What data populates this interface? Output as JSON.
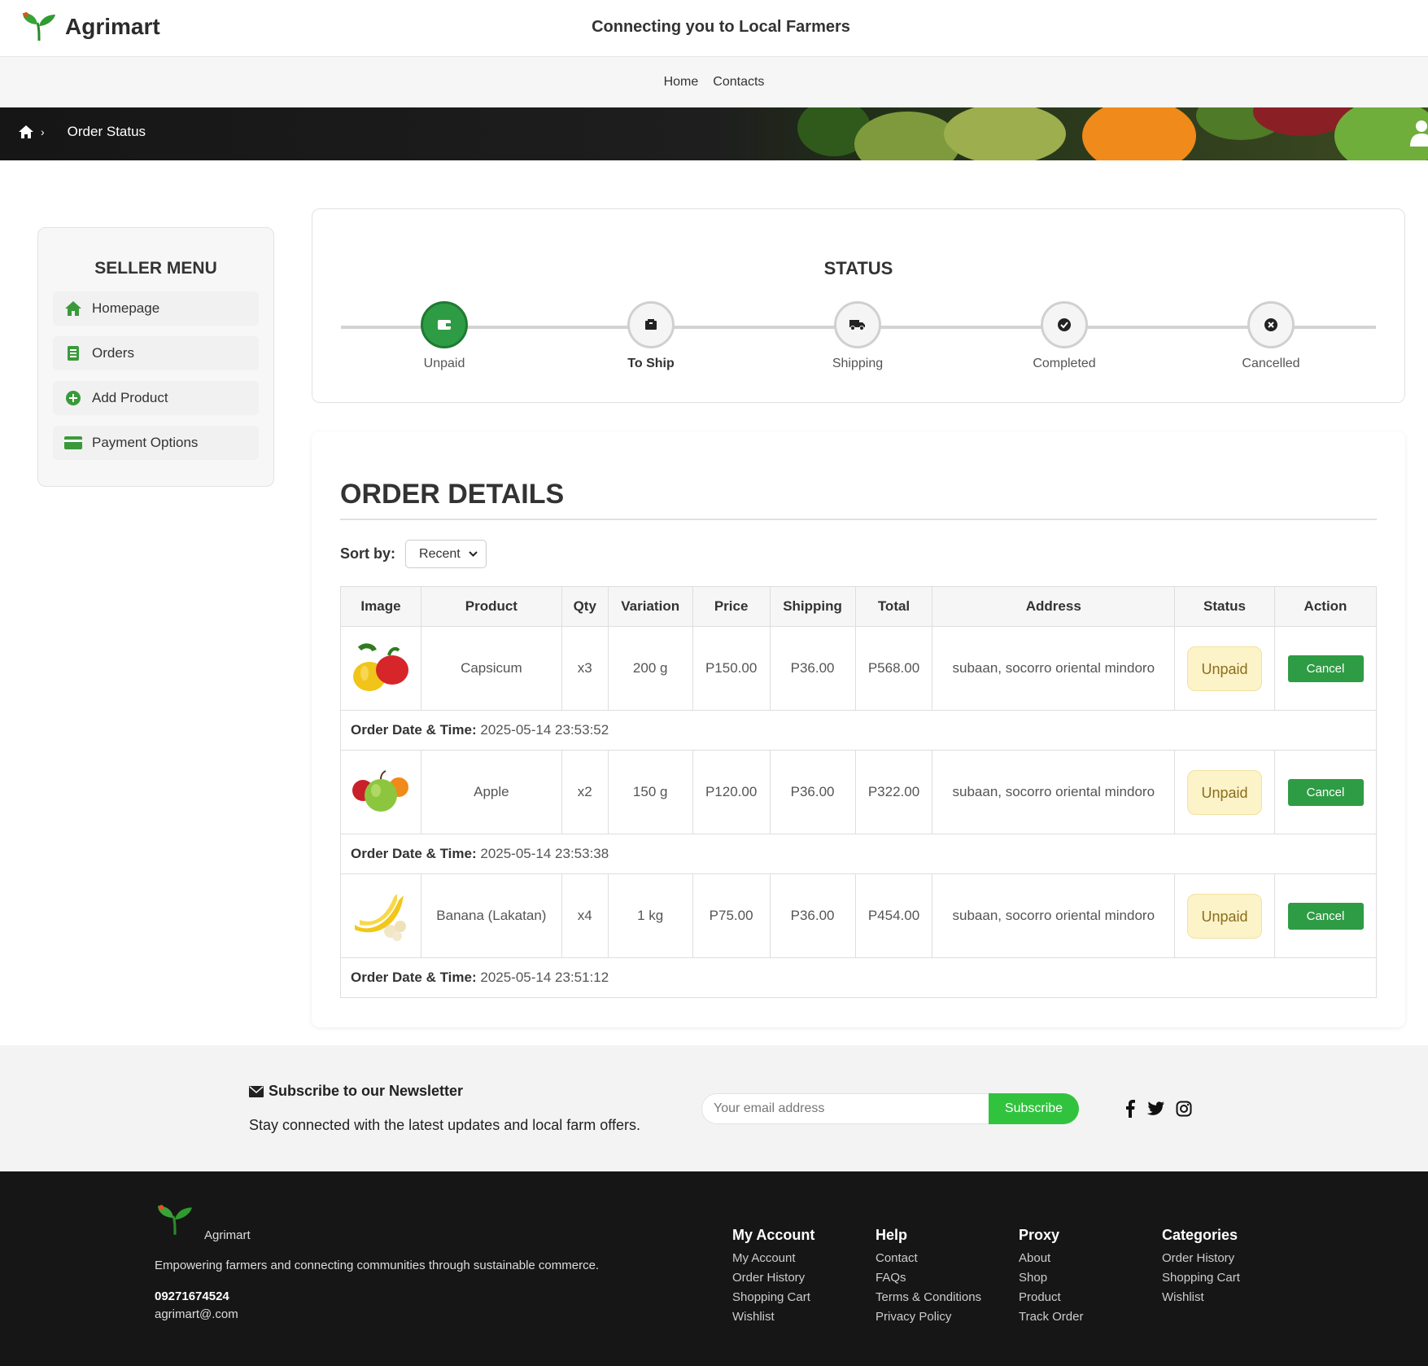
{
  "header": {
    "brand": "Agrimart",
    "tagline": "Connecting you to Local Farmers"
  },
  "nav": {
    "home": "Home",
    "contacts": "Contacts"
  },
  "breadcrumb": {
    "current": "Order Status"
  },
  "sidebar": {
    "title": "SELLER MENU",
    "items": [
      {
        "label": "Homepage",
        "icon": "house-icon"
      },
      {
        "label": "Orders",
        "icon": "clipboard-icon"
      },
      {
        "label": "Add Product",
        "icon": "plus-circle-icon"
      },
      {
        "label": "Payment Options",
        "icon": "credit-card-icon"
      }
    ]
  },
  "status": {
    "title": "STATUS",
    "steps": [
      {
        "label": "Unpaid",
        "icon": "wallet-icon",
        "active": true
      },
      {
        "label": "To Ship",
        "icon": "box-icon",
        "active": false
      },
      {
        "label": "Shipping",
        "icon": "truck-icon",
        "active": false
      },
      {
        "label": "Completed",
        "icon": "check-icon",
        "active": false
      },
      {
        "label": "Cancelled",
        "icon": "x-icon",
        "active": false
      }
    ]
  },
  "order_details": {
    "title": "ORDER DETAILS",
    "sort_label": "Sort by:",
    "sort_value": "Recent",
    "columns": [
      "Image",
      "Product",
      "Qty",
      "Variation",
      "Price",
      "Shipping",
      "Total",
      "Address",
      "Status",
      "Action"
    ],
    "date_label": "Order Date & Time:",
    "orders": [
      {
        "product": "Capsicum",
        "qty": "x3",
        "variation": "200 g",
        "price": "P150.00",
        "shipping": "P36.00",
        "total": "P568.00",
        "address": "subaan, socorro oriental mindoro",
        "status": "Unpaid",
        "action": "Cancel",
        "datetime": "2025-05-14 23:53:52"
      },
      {
        "product": "Apple",
        "qty": "x2",
        "variation": "150 g",
        "price": "P120.00",
        "shipping": "P36.00",
        "total": "P322.00",
        "address": "subaan, socorro oriental mindoro",
        "status": "Unpaid",
        "action": "Cancel",
        "datetime": "2025-05-14 23:53:38"
      },
      {
        "product": "Banana (Lakatan)",
        "qty": "x4",
        "variation": "1 kg",
        "price": "P75.00",
        "shipping": "P36.00",
        "total": "P454.00",
        "address": "subaan, socorro oriental mindoro",
        "status": "Unpaid",
        "action": "Cancel",
        "datetime": "2025-05-14 23:51:12"
      }
    ]
  },
  "newsletter": {
    "title": "Subscribe to our Newsletter",
    "description": "Stay connected with the latest updates and local farm offers.",
    "placeholder": "Your email address",
    "button": "Subscribe"
  },
  "footer": {
    "brand": "Agrimart",
    "description": "Empowering farmers and connecting communities through sustainable commerce.",
    "phone": "09271674524",
    "email": "agrimart@.com",
    "columns": [
      {
        "title": "My Account",
        "links": [
          "My Account",
          "Order History",
          "Shopping Cart",
          "Wishlist"
        ]
      },
      {
        "title": "Help",
        "links": [
          "Contact",
          "FAQs",
          "Terms & Conditions",
          "Privacy Policy"
        ]
      },
      {
        "title": "Proxy",
        "links": [
          "About",
          "Shop",
          "Product",
          "Track Order"
        ]
      },
      {
        "title": "Categories",
        "links": [
          "Order History",
          "Shopping Cart",
          "Wishlist"
        ]
      }
    ]
  },
  "colors": {
    "accent": "#2e9c44",
    "subscribe": "#31c33e",
    "badge_bg": "#fdf3c8",
    "footer_bg": "#161616"
  }
}
